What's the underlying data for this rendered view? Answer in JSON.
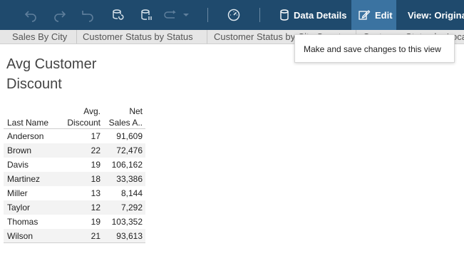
{
  "toolbar": {
    "icons": [
      "undo-icon",
      "redo-icon",
      "revert-icon",
      "refresh-icon",
      "pause-updates-icon",
      "share-icon",
      "chevron-down-icon",
      "performance-icon",
      "database-icon",
      "edit-icon",
      "view-icon"
    ],
    "data_details_label": "Data Details",
    "edit_label": "Edit",
    "view_label": "View: Original",
    "colors": {
      "bar": "#1f4a6d",
      "active": "#3b73a1"
    }
  },
  "tabs": [
    {
      "label": "Sales By City"
    },
    {
      "label": "Customer Status by Status"
    },
    {
      "label": "Customer Status by City Count"
    },
    {
      "label": "Customer Status by Location"
    }
  ],
  "tooltip": {
    "text": "Make and save changes to this view"
  },
  "view": {
    "title_line1": "Avg Customer",
    "title_line2": "Discount",
    "table": {
      "headers": {
        "name": "Last Name",
        "discount_line1": "Avg.",
        "discount_line2": "Discount",
        "sales_line1": "Net",
        "sales_line2": "Sales A.."
      },
      "rows": [
        {
          "name": "Anderson",
          "discount": "17",
          "sales": "91,609"
        },
        {
          "name": "Brown",
          "discount": "22",
          "sales": "72,476"
        },
        {
          "name": "Davis",
          "discount": "19",
          "sales": "106,162"
        },
        {
          "name": "Martinez",
          "discount": "18",
          "sales": "33,386"
        },
        {
          "name": "Miller",
          "discount": "13",
          "sales": "8,144"
        },
        {
          "name": "Taylor",
          "discount": "12",
          "sales": "7,292"
        },
        {
          "name": "Thomas",
          "discount": "19",
          "sales": "103,352"
        },
        {
          "name": "Wilson",
          "discount": "21",
          "sales": "93,613"
        }
      ]
    }
  }
}
